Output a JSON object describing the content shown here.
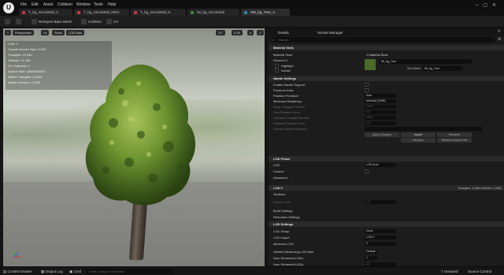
{
  "menu": [
    "File",
    "Edit",
    "Asset",
    "Collision",
    "Window",
    "Tools",
    "Help"
  ],
  "tabs": [
    {
      "label": "T_bg_StockWall_C",
      "color": "#c33a4a"
    },
    {
      "label": "T_bg_StockWall_MRO",
      "color": "#c33a4a"
    },
    {
      "label": "T_bg_StockWall_N",
      "color": "#c33a4a"
    },
    {
      "label": "MI_bg_StockWall",
      "color": "#3a8a3a"
    },
    {
      "label": "SM_bg_Tree_A",
      "color": "#2a8aa0"
    }
  ],
  "toolbar": {
    "reimport_label": "Reimport Base Mesh",
    "collision_label": "Collision",
    "uv_label": "UV"
  },
  "viewport": {
    "perspective_label": "Perspective",
    "lit_label": "Lit",
    "show_label": "Show",
    "lod_label": "LOD Auto",
    "snap_angle": "10°",
    "scale": "0.25",
    "speed": "4",
    "stats": [
      "LOD: 0",
      "Current Screen Size: 0.676",
      "Triangles: 10,944",
      "Vertices: 11,318",
      "UV Channels: 1",
      "Approx Size: 448x330x524",
      "Nanite Triangles: 10,944",
      "Nanite Vertices: 11,318"
    ]
  },
  "details": {
    "tab_details": "Details",
    "tab_outliner": "Socket Manager",
    "search_placeholder": "Search",
    "material_slots": {
      "header": "Material Slots",
      "row_label": "Material Slots",
      "row_value": "1 Material Slots",
      "element_label": "Element 0",
      "highlight_label": "Highlight",
      "isolate_label": "Isolate",
      "material_name": "MI_bg_Tree",
      "slot_label": "Slot Name",
      "slot_value": "MI_bg_Tree"
    },
    "nanite": {
      "header": "Nanite Settings",
      "rows": [
        {
          "label": "Enable Nanite Support",
          "type": "check",
          "value": ""
        },
        {
          "label": "Preserve Area",
          "type": "check",
          "value": ""
        },
        {
          "label": "Position Precision",
          "type": "field",
          "value": "Auto"
        },
        {
          "label": "Minimum Residency",
          "type": "field",
          "value": "Minimal (32KB)"
        },
        {
          "label": "Keep Triangle Percent",
          "type": "field",
          "value": "100.0",
          "dim": true
        },
        {
          "label": "Trim Relative Error",
          "type": "field",
          "value": "0.0",
          "dim": true
        },
        {
          "label": "Fallback Triangle Percent",
          "type": "field",
          "value": "100.0",
          "dim": true
        },
        {
          "label": "Fallback Relative Error",
          "type": "field",
          "value": "1.0",
          "dim": true
        },
        {
          "label": "Source Import Filename",
          "type": "field",
          "value": "",
          "dim": true
        }
      ],
      "btn_apply": "Apply Changes",
      "btn_import": "Import",
      "btn_reimport": "Reimport",
      "btn_remove": "Remove",
      "btn_nanite": "Remove Source File"
    },
    "lod_picker": {
      "header": "LOD Picker",
      "lod_label": "LOD",
      "lod_value": "LOD Auto",
      "custom_label": "Custom",
      "advanced_label": "Advanced"
    },
    "lod0": {
      "header": "LOD 0",
      "triangles": "Triangles: 3,464",
      "vertices": "Vertices: 3,406",
      "sections_label": "Sections",
      "screen_size_label": "Screen Size",
      "screen_size_value": "1.0",
      "build_label": "Build Settings",
      "reduction_label": "Reduction Settings"
    },
    "lod_settings": {
      "header": "LOD Settings",
      "rows": [
        {
          "label": "LOD Group",
          "value": "None"
        },
        {
          "label": "LOD Import",
          "value": "LOD 0"
        },
        {
          "label": "Minimum LOD",
          "value": "0"
        },
        {
          "label": "Wanted Streaming LOD Bias",
          "value": "Default"
        },
        {
          "label": "Num Streamed LODs",
          "value": "1"
        },
        {
          "label": "Num Streamed LODs",
          "value": "-1"
        }
      ]
    }
  },
  "statusbar": {
    "content_drawer": "Content Drawer",
    "output_log": "Output Log",
    "cmd": "Cmd",
    "cmd_placeholder": "Enter Console Command",
    "unsaved": "7 Unsaved",
    "source_control": "Source Control"
  },
  "colors": {
    "accent": "#2a8aa0",
    "tree_leaf": "#5e8a2c"
  }
}
